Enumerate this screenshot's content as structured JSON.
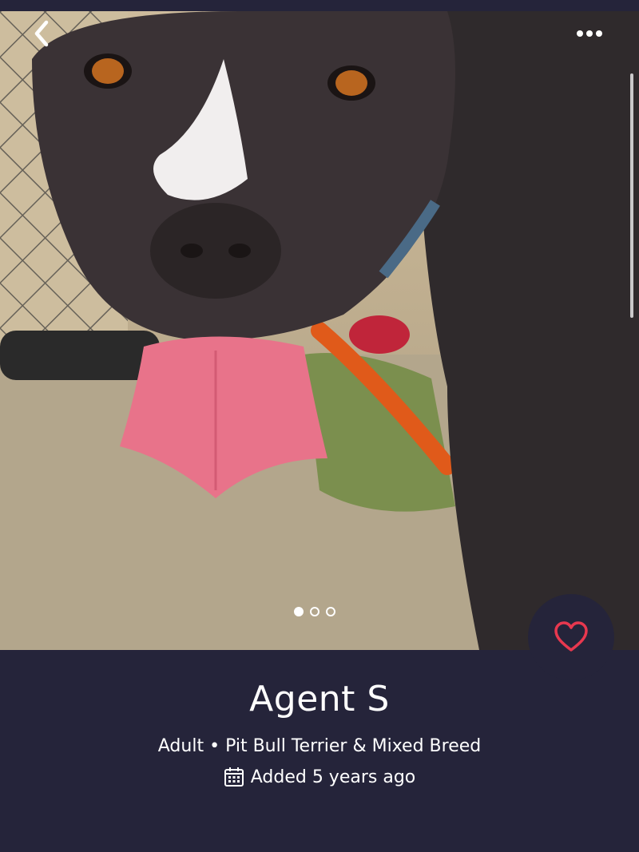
{
  "header": {
    "back_icon": "chevron-left-icon",
    "more_icon": "more-horizontal-icon"
  },
  "gallery": {
    "dots_total": 3,
    "active_index": 0
  },
  "favorite": {
    "icon": "heart-outline-icon",
    "color": "#e8384f"
  },
  "pet": {
    "name": "Agent S",
    "age": "Adult",
    "separator": "•",
    "breed": "Pit Bull Terrier & Mixed Breed",
    "added": "Added 5 years ago",
    "added_icon": "calendar-icon"
  },
  "colors": {
    "background": "#25243a",
    "text": "#ffffff"
  }
}
